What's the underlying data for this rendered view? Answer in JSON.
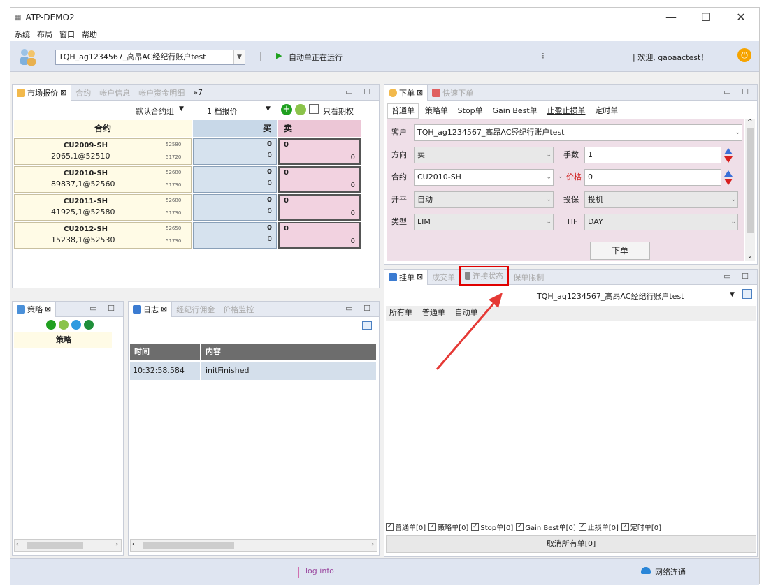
{
  "window": {
    "title": "ATP-DEMO2",
    "minimize": "—",
    "maximize": "☐",
    "close": "✕"
  },
  "menu": [
    "系统",
    "布局",
    "窗口",
    "帮助"
  ],
  "toolbar": {
    "account": "TQH_ag1234567_高昂AC经纪行账户test",
    "status": "自动单正在运行",
    "separator": "|",
    "middle_mark": "⁝",
    "welcome": "| 欢迎, gaoaactest！"
  },
  "market": {
    "tabs": [
      "市场报价",
      "合约",
      "帐户信息",
      "帐户资金明细"
    ],
    "overflow": "»7",
    "group": "默认合约组",
    "depth": "1 档报价",
    "only_options": "只看期权",
    "headers": {
      "contract": "合约",
      "buy": "买",
      "sell": "卖"
    },
    "rows": [
      {
        "code": "CU2009-SH",
        "info": "2065,1@52510",
        "p1": "52580",
        "p2": "51720",
        "b1": "0",
        "b2": "0",
        "s1": "0",
        "s2": "0"
      },
      {
        "code": "CU2010-SH",
        "info": "89837,1@52560",
        "p1": "52680",
        "p2": "51730",
        "b1": "0",
        "b2": "0",
        "s1": "0",
        "s2": "0"
      },
      {
        "code": "CU2011-SH",
        "info": "41925,1@52580",
        "p1": "52680",
        "p2": "51730",
        "b1": "0",
        "b2": "0",
        "s1": "0",
        "s2": "0"
      },
      {
        "code": "CU2012-SH",
        "info": "15238,1@52530",
        "p1": "52650",
        "p2": "51730",
        "b1": "0",
        "b2": "0",
        "s1": "0",
        "s2": "0"
      }
    ]
  },
  "strategy": {
    "tab": "策略",
    "header": "策略"
  },
  "log": {
    "tabs": [
      "日志",
      "经纪行佣金",
      "价格监控"
    ],
    "headers": {
      "time": "时间",
      "content": "内容"
    },
    "rows": [
      {
        "time": "10:32:58.584",
        "content": "initFinished"
      }
    ]
  },
  "order": {
    "tabs": [
      "下单",
      "快速下单"
    ],
    "subtabs": [
      "普通单",
      "策略单",
      "Stop单",
      "Gain Best单",
      "止盈止损单",
      "定时单"
    ],
    "labels": {
      "customer": "客户",
      "direction": "方向",
      "qty": "手数",
      "contract": "合约",
      "price": "价格",
      "openclose": "开平",
      "hedge": "投保",
      "type": "类型",
      "tif": "TIF"
    },
    "values": {
      "customer": "TQH_ag1234567_高昂AC经纪行账户test",
      "direction": "卖",
      "qty": "1",
      "contract": "CU2010-SH",
      "price": "0",
      "openclose": "自动",
      "hedge": "投机",
      "type": "LIM",
      "tif": "DAY"
    },
    "submit": "下单"
  },
  "pending": {
    "tabs": [
      "挂单",
      "成交单",
      "连接状态",
      "保单限制"
    ],
    "account": "TQH_ag1234567_高昂AC经纪行账户test",
    "subtabs": [
      "所有单",
      "普通单",
      "自动单"
    ],
    "checks": [
      "普通单[0]",
      "策略单[0]",
      "Stop单[0]",
      "Gain Best单[0]",
      "止损单[0]",
      "定时单[0]"
    ],
    "cancel_all": "取消所有单[0]"
  },
  "status": {
    "log_info": "log info",
    "network": "网络连通"
  },
  "colors": {
    "accent_red": "#e53935",
    "buy_bg": "#d6e2ee",
    "sell_bg": "#f2d2e0",
    "highlight": "#e00000"
  }
}
